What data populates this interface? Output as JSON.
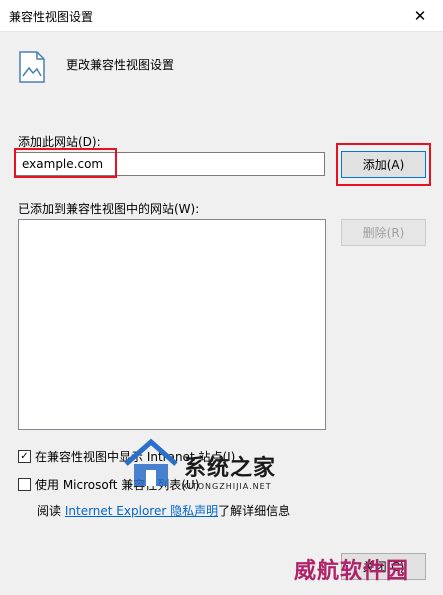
{
  "window": {
    "title": "兼容性视图设置",
    "close_glyph": "✕"
  },
  "heading": "更改兼容性视图设置",
  "add_site": {
    "label": "添加此网站(D):",
    "value": "example.com",
    "button": "添加(A)"
  },
  "sites_list": {
    "label": "已添加到兼容性视图中的网站(W):",
    "remove_button": "删除(R)"
  },
  "options": {
    "intranet": {
      "label": "在兼容性视图中显示 Intranet 站点(I)",
      "checked": true
    },
    "ms_list": {
      "label": "使用 Microsoft 兼容性列表(U)",
      "checked": false
    }
  },
  "privacy": {
    "prefix": "阅读",
    "link": "Internet Explorer 隐私声明",
    "suffix": "了解详细信息"
  },
  "close_button": "关闭(C)",
  "watermarks": {
    "main": "系统之家",
    "sub": "XITONGZHIJIA.NET",
    "bottom": "威航软件园"
  },
  "colors": {
    "highlight": "#e81123",
    "link": "#0066cc",
    "accent": "#0078d7"
  },
  "icons": {
    "title_close": "close-icon",
    "page": "page-icon",
    "check": "checkmark-icon"
  }
}
